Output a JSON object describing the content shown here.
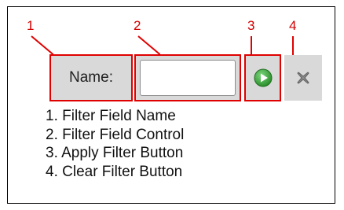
{
  "callouts": [
    "1",
    "2",
    "3",
    "4"
  ],
  "filter_bar": {
    "name_label": "Name:",
    "input_value": "",
    "apply_icon": "play-circle-icon",
    "clear_icon": "x-icon"
  },
  "legend": [
    "1. Filter Field Name",
    "2. Filter Field Control",
    "3. Apply Filter Button",
    "4. Clear Filter Button"
  ],
  "colors": {
    "callout": "#e00000",
    "toolbar_bg": "#d9d9d9",
    "apply_green": "#3aa53a",
    "clear_gray": "#8a8a8a"
  }
}
